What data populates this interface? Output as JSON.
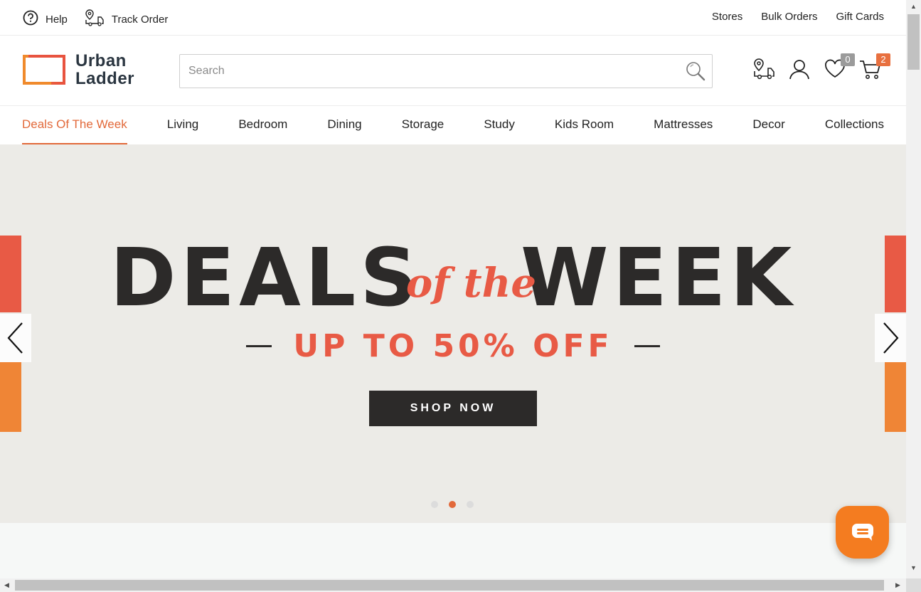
{
  "utility": {
    "help_label": "Help",
    "track_label": "Track Order",
    "right_links": [
      "Stores",
      "Bulk Orders",
      "Gift Cards"
    ]
  },
  "header": {
    "logo_line1": "Urban",
    "logo_line2": "Ladder",
    "search_placeholder": "Search",
    "wishlist_count": "0",
    "cart_count": "2",
    "icons": [
      "track-order-icon",
      "account-icon",
      "wishlist-icon",
      "cart-icon"
    ]
  },
  "nav": {
    "items": [
      "Deals Of The Week",
      "Living",
      "Bedroom",
      "Dining",
      "Storage",
      "Study",
      "Kids Room",
      "Mattresses",
      "Decor",
      "Collections"
    ],
    "active_index": 0
  },
  "hero": {
    "title_left": "DEALS",
    "title_script": "of the",
    "title_right": "WEEK",
    "subtitle": "UP TO 50% OFF",
    "cta": "SHOP NOW",
    "slide_count": 3,
    "active_slide": 1
  },
  "colors": {
    "accent": "#e2693a",
    "hero_red": "#e85a45",
    "hero_orange": "#ef8536",
    "hero_bg": "#ecebe7",
    "chat": "#f47c20"
  }
}
